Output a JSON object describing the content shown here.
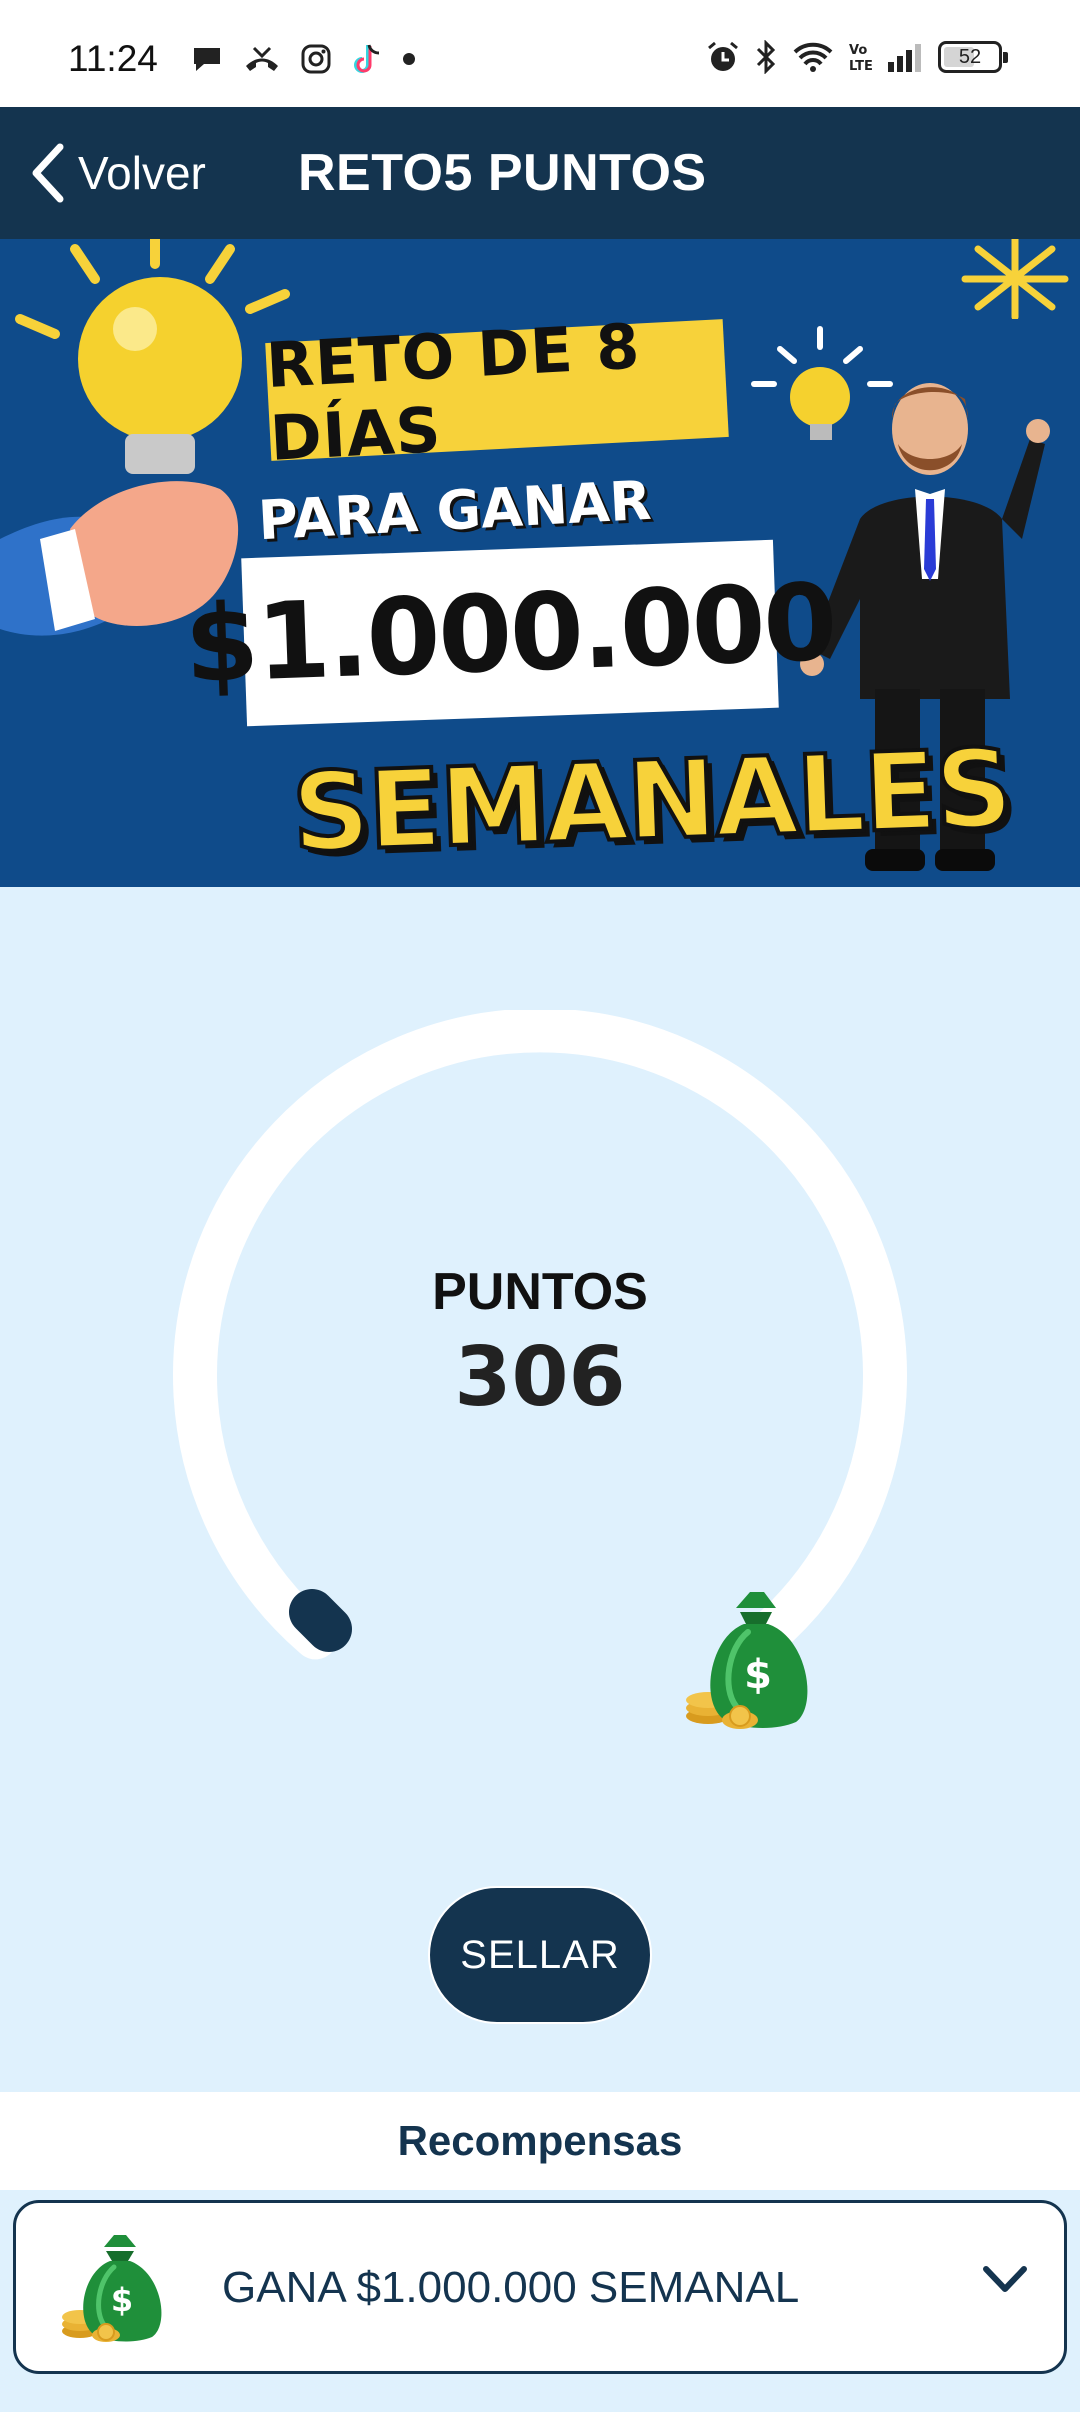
{
  "status_bar": {
    "time": "11:24",
    "battery_level": "52",
    "left_icons": [
      "chat-icon",
      "missed-call-icon",
      "instagram-icon",
      "tiktok-icon",
      "dot-icon"
    ],
    "right_icons": [
      "alarm-icon",
      "bluetooth-icon",
      "wifi-icon",
      "volte-icon",
      "signal-icon",
      "battery-icon"
    ]
  },
  "nav": {
    "back_label": "Volver",
    "title": "RETO5 PUNTOS"
  },
  "banner": {
    "line1": "RETO DE 8 DÍAS",
    "line2": "PARA GANAR",
    "amount": "$1.000.000",
    "line4": "SEMANALES"
  },
  "progress": {
    "label": "PUNTOS",
    "value": "306"
  },
  "actions": {
    "seal_label": "SELLAR"
  },
  "rewards": {
    "title": "Recompensas",
    "items": [
      {
        "label": "GANA $1.000.000 SEMANAL",
        "icon": "money-bag-icon"
      }
    ]
  },
  "colors": {
    "navy": "#14344f",
    "background": "#dff1fd",
    "banner_blue": "#0f4b8a",
    "yellow": "#f7d23a",
    "money_green": "#1f8f3a"
  }
}
